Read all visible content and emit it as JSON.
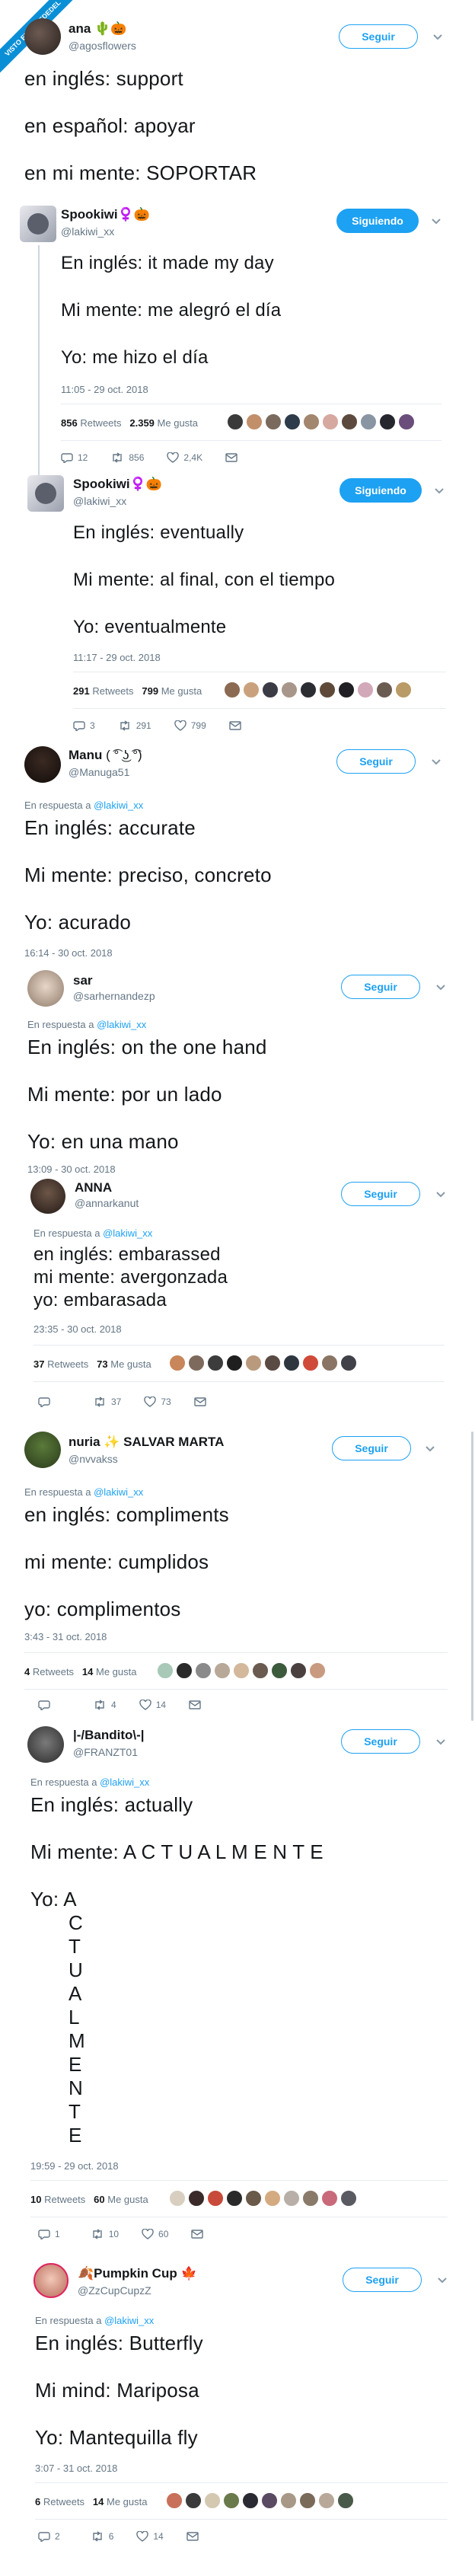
{
  "watermark": "VISTO EN LAREDEDEL",
  "colors": {
    "accent": "#1da1f2",
    "muted": "#657786",
    "border": "#e6ecf0"
  },
  "tweets": [
    {
      "name": "ana",
      "name_emoji": "🌵🎃",
      "handle": "@agosflowers",
      "button": "Seguir",
      "lines": [
        "en inglés: support",
        "en español: apoyar",
        "en mi mente: SOPORTAR"
      ]
    },
    {
      "name": "Spookiwi",
      "name_emoji": "♀️🎃",
      "handle": "@lakiwi_xx",
      "button": "Siguiendo",
      "lines": [
        "En inglés: it made my day",
        "Mi mente: me alegró el día",
        "Yo: me hizo el día"
      ],
      "timestamp": "11:05 - 29 oct. 2018",
      "retweets": "856",
      "retweets_label": "Retweets",
      "likes": "2.359",
      "likes_label": "Me gusta",
      "actions": {
        "reply": "12",
        "retweet": "856",
        "like": "2,4K"
      }
    },
    {
      "name": "Spookiwi",
      "name_emoji": "♀️🎃",
      "handle": "@lakiwi_xx",
      "button": "Siguiendo",
      "lines": [
        "En inglés: eventually",
        "Mi mente: al final, con el tiempo",
        "Yo: eventualmente"
      ],
      "timestamp": "11:17 - 29 oct. 2018",
      "retweets": "291",
      "retweets_label": "Retweets",
      "likes": "799",
      "likes_label": "Me gusta",
      "actions": {
        "reply": "3",
        "retweet": "291",
        "like": "799"
      }
    },
    {
      "name": "Manu",
      "name_emoji": "( ͡° ͜ʖ ͡°)",
      "handle": "@Manuga51",
      "button": "Seguir",
      "reply_prefix": "En respuesta a",
      "reply_to": "@lakiwi_xx",
      "lines": [
        "En inglés: accurate",
        "Mi mente: preciso, concreto",
        "Yo: acurado"
      ],
      "timestamp": "16:14 - 30 oct. 2018"
    },
    {
      "name": "sar",
      "handle": "@sarhernandezp",
      "button": "Seguir",
      "reply_prefix": "En respuesta a",
      "reply_to": "@lakiwi_xx",
      "lines": [
        "En inglés: on the one hand",
        "Mi mente: por un lado",
        "Yo: en una mano"
      ],
      "timestamp": "13:09 - 30 oct. 2018"
    },
    {
      "name": "ANNA",
      "handle": "@annarkanut",
      "button": "Seguir",
      "reply_prefix": "En respuesta a",
      "reply_to": "@lakiwi_xx",
      "lines": [
        "en inglés: embarassed",
        "mi mente: avergonzada",
        "yo: embarasada"
      ],
      "timestamp": "23:35 - 30 oct. 2018",
      "retweets": "37",
      "retweets_label": "Retweets",
      "likes": "73",
      "likes_label": "Me gusta",
      "actions": {
        "reply": "",
        "retweet": "37",
        "like": "73"
      }
    },
    {
      "name": "nuria",
      "name_emoji": "✨ SALVAR MARTA",
      "handle": "@nvvakss",
      "button": "Seguir",
      "reply_prefix": "En respuesta a",
      "reply_to": "@lakiwi_xx",
      "lines": [
        "en inglés: compliments",
        "mi mente: cumplidos",
        "yo: complimentos"
      ],
      "timestamp": "3:43 - 31 oct. 2018",
      "retweets": "4",
      "retweets_label": "Retweets",
      "likes": "14",
      "likes_label": "Me gusta",
      "actions": {
        "reply": "",
        "retweet": "4",
        "like": "14"
      }
    },
    {
      "name": "|-/Bandito\\-|",
      "handle": "@FRANZT01",
      "button": "Seguir",
      "reply_prefix": "En respuesta a",
      "reply_to": "@lakiwi_xx",
      "lines": [
        "En inglés: actually",
        "Mi mente: A C T U A L M E N T E",
        "Yo: A"
      ],
      "vertical": [
        "C",
        "T",
        "U",
        "A",
        "L",
        "M",
        "E",
        "N",
        "T",
        "E"
      ],
      "timestamp": "19:59 - 29 oct. 2018",
      "retweets": "10",
      "retweets_label": "Retweets",
      "likes": "60",
      "likes_label": "Me gusta",
      "actions": {
        "reply": "1",
        "retweet": "10",
        "like": "60"
      }
    },
    {
      "name": "Pumpkin Cup",
      "name_emoji": "🍂",
      "name_emoji2": "🍁",
      "handle": "@ZzCupCupzZ",
      "button": "Seguir",
      "reply_prefix": "En respuesta a",
      "reply_to": "@lakiwi_xx",
      "lines": [
        "En inglés: Butterfly",
        "Mi mind: Mariposa",
        "Yo: Mantequilla fly"
      ],
      "timestamp": "3:07 - 31 oct. 2018",
      "retweets": "6",
      "retweets_label": "Retweets",
      "likes": "14",
      "likes_label": "Me gusta",
      "actions": {
        "reply": "2",
        "retweet": "6",
        "like": "14"
      }
    }
  ]
}
